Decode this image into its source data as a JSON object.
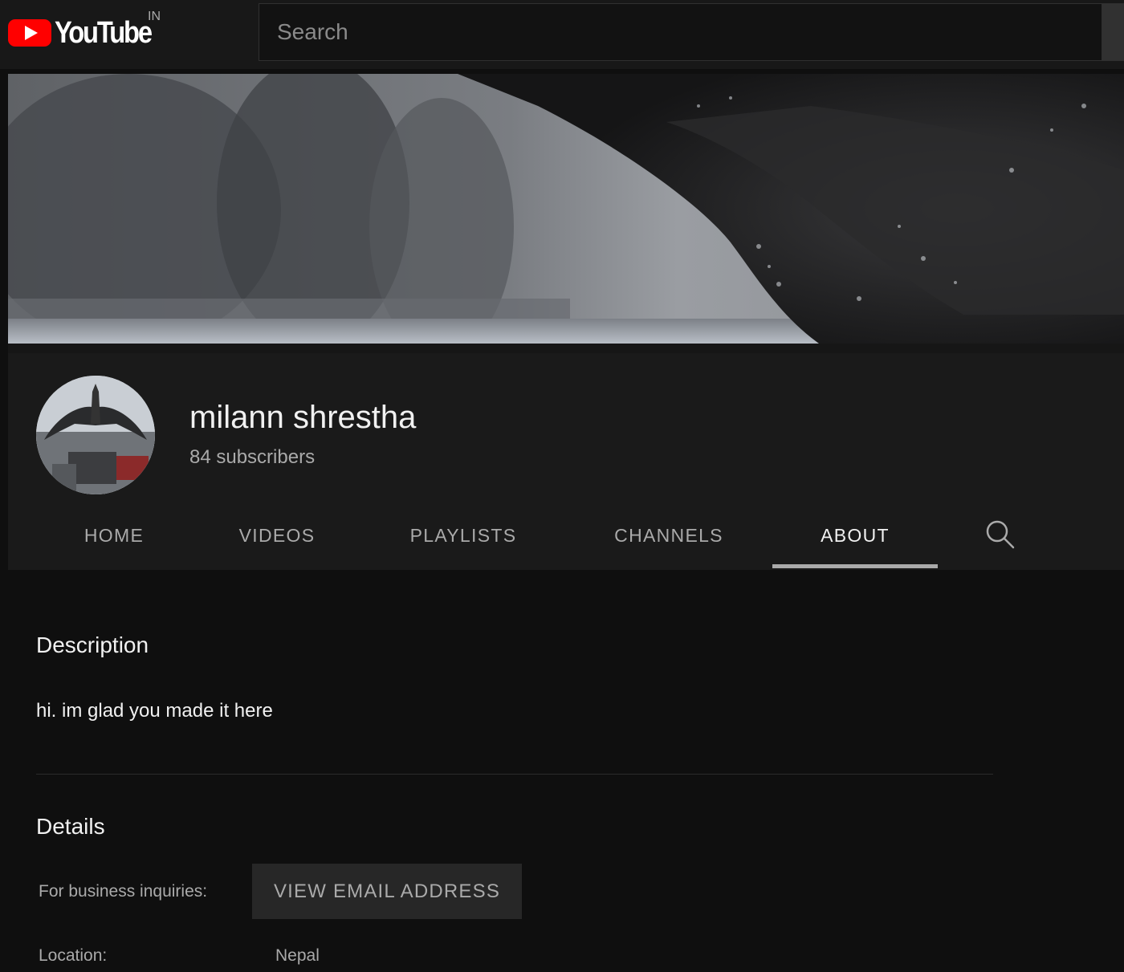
{
  "masthead": {
    "logo_text": "YouTube",
    "country_code": "IN",
    "search_placeholder": "Search"
  },
  "channel": {
    "name": "milann shrestha",
    "subscribers": "84 subscribers"
  },
  "tabs": [
    {
      "label": "HOME",
      "active": false
    },
    {
      "label": "VIDEOS",
      "active": false
    },
    {
      "label": "PLAYLISTS",
      "active": false
    },
    {
      "label": "CHANNELS",
      "active": false
    },
    {
      "label": "ABOUT",
      "active": true
    }
  ],
  "about": {
    "description_heading": "Description",
    "description_text": "hi. im glad you made it here",
    "details_heading": "Details",
    "business_label": "For business inquiries:",
    "email_button_label": "VIEW EMAIL ADDRESS",
    "location_label": "Location:",
    "location_value": "Nepal"
  },
  "colors": {
    "brand_red": "#ff0000",
    "background": "#0f0f0f",
    "header_bg": "#1a1a1a",
    "text_primary": "#f1f1f1",
    "text_secondary": "#aaaaaa"
  },
  "icons": {
    "logo": "youtube-play-icon",
    "tab_search": "search-icon"
  }
}
